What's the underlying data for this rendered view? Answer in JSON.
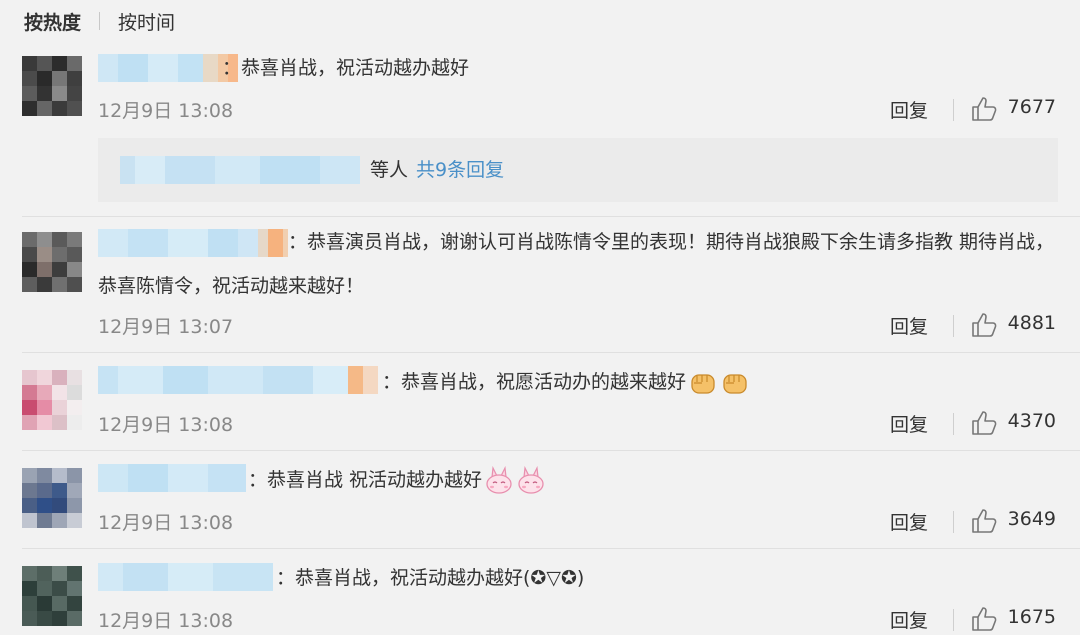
{
  "sort": {
    "active": "按热度",
    "inactive": "按时间"
  },
  "actions": {
    "reply_label": "回复"
  },
  "comments": [
    {
      "text": "：恭喜肖战，祝活动越办越好",
      "time": "12月9日 13:08",
      "likes": "7677"
    },
    {
      "text": "：恭喜演员肖战，谢谢认可肖战陈情令里的表现！期待肖战狼殿下余生请多指教 期待肖战，恭喜陈情令，祝活动越来越好！",
      "time": "12月9日 13:07",
      "likes": "4881"
    },
    {
      "text": "：恭喜肖战，祝愿活动办的越来越好",
      "time": "12月9日 13:08",
      "likes": "4370"
    },
    {
      "text": "：恭喜肖战 祝活动越办越好",
      "time": "12月9日 13:08",
      "likes": "3649"
    },
    {
      "text": "：恭喜肖战，祝活动越办越好(✪▽✪)",
      "time": "12月9日 13:08",
      "likes": "1675"
    }
  ],
  "sub_replies": {
    "suffix": "等人",
    "link": "共9条回复"
  },
  "icons": {
    "like": "thumbs-up-icon",
    "fist": "fist-emoji-icon",
    "bunny": "bunny-emoji-icon"
  },
  "colors": {
    "link": "#4a90c8",
    "background": "#f2f2f2",
    "meta": "#888888"
  }
}
